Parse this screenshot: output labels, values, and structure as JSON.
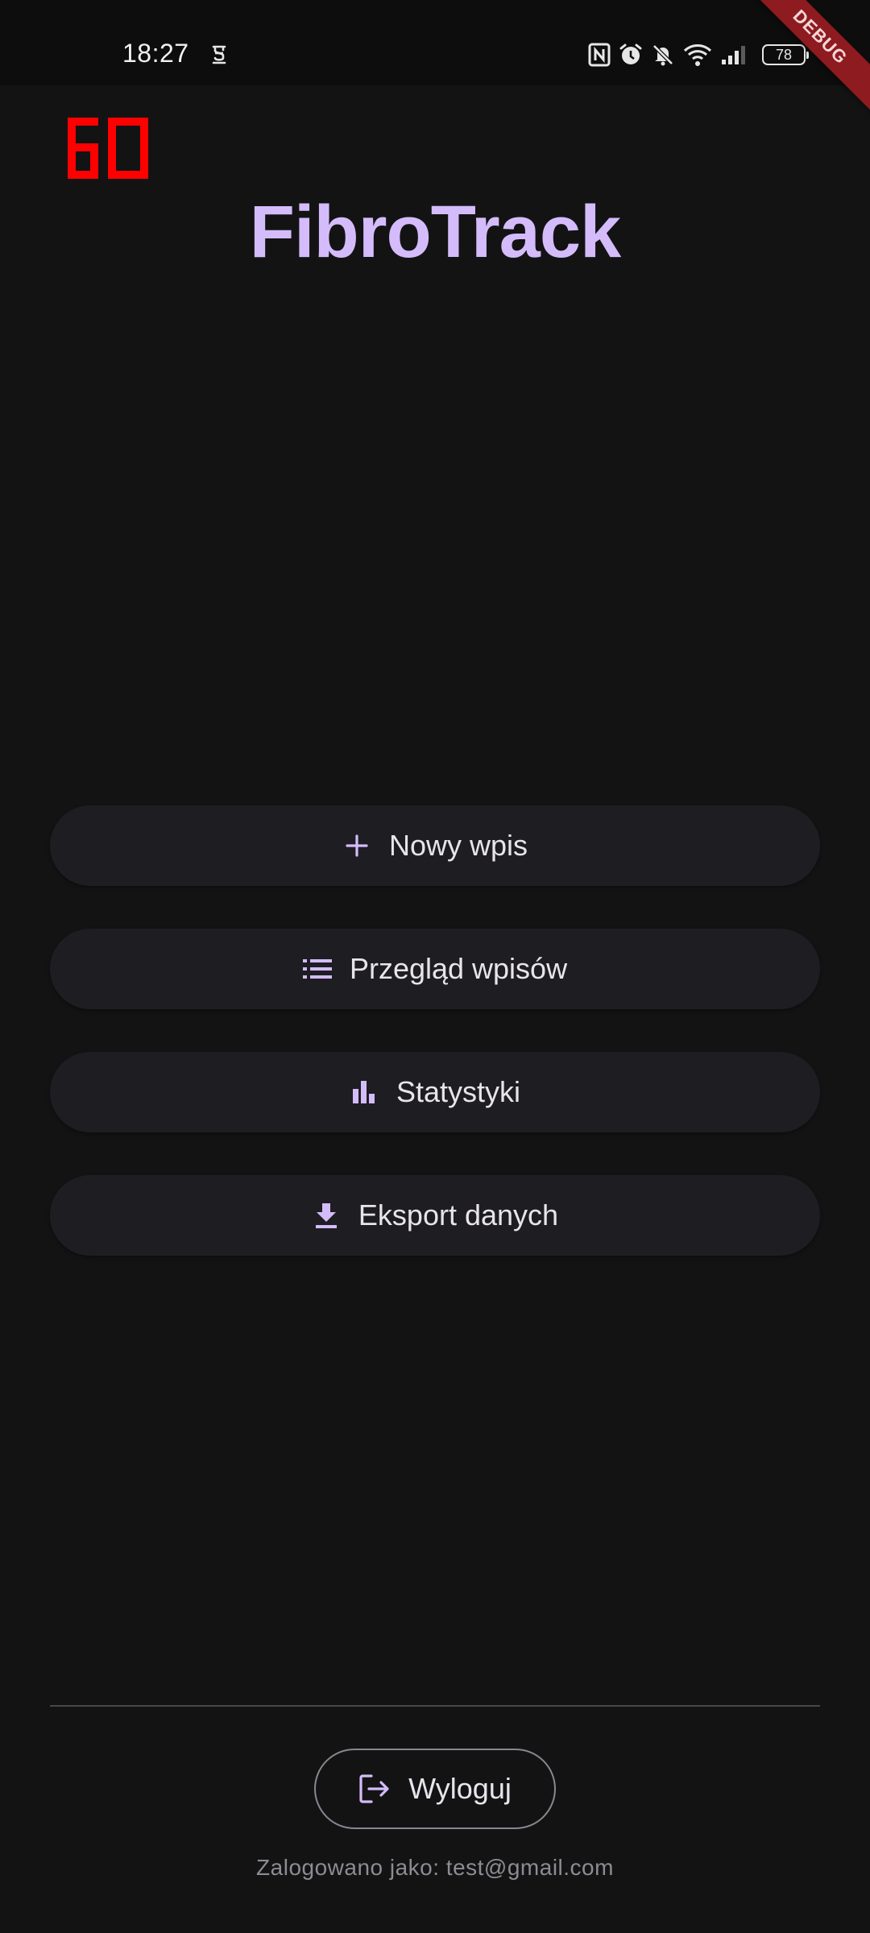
{
  "status_bar": {
    "time": "18:27",
    "battery_level": "78",
    "icons": [
      "nfc-icon",
      "alarm-icon",
      "bell-off-icon",
      "wifi-icon",
      "signal-icon",
      "battery-icon"
    ]
  },
  "debug_banner": "DEBUG",
  "fps_counter": "60",
  "app": {
    "title": "FibroTrack"
  },
  "menu": {
    "items": [
      {
        "label": "Nowy wpis",
        "icon": "plus-icon"
      },
      {
        "label": "Przegląd wpisów",
        "icon": "list-icon"
      },
      {
        "label": "Statystyki",
        "icon": "bar-chart-icon"
      },
      {
        "label": "Eksport danych",
        "icon": "download-icon"
      }
    ]
  },
  "footer": {
    "logout_label": "Wyloguj",
    "logged_in_as": "Zalogowano jako: test@gmail.com"
  },
  "colors": {
    "accent": "#d4bcfb",
    "background": "#131314",
    "button_bg": "#1e1d22",
    "fps_red": "#ff0000",
    "debug_red": "#8e1b1f"
  }
}
